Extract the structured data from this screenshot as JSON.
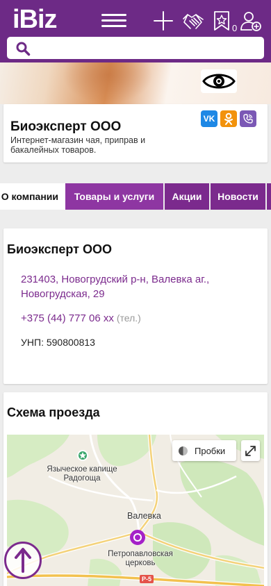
{
  "header": {
    "logo": "iBiz",
    "cart_count": "0",
    "icons": [
      "menu-icon",
      "plus-icon",
      "handshake-icon",
      "star-bookmark-icon",
      "add-user-icon"
    ]
  },
  "search": {
    "placeholder": "",
    "value": ""
  },
  "company": {
    "name": "Биоэксперт ООО",
    "description": "Интернет-магазин чая, приправ и бакалейных товаров.",
    "social": {
      "vk": "VK",
      "ok": "OK",
      "viber": ""
    }
  },
  "tabs": [
    {
      "label": "О компании",
      "active": true
    },
    {
      "label": "Товары и услуги",
      "active": false
    },
    {
      "label": "Акции",
      "active": false
    },
    {
      "label": "Новости",
      "active": false
    },
    {
      "label": "",
      "active": false
    }
  ],
  "info": {
    "title": "Биоэксперт ООО",
    "address": "231403, Новогрудский р-н, Валевка аг., Новогрудская, 29",
    "phone": "+375 (44) 777 06 xx",
    "phone_note": "(тел.)",
    "unp": "УНП: 590800813"
  },
  "map": {
    "title": "Схема проезда",
    "traffic_label": "Пробки",
    "labels": {
      "poi": "Языческое капище Радогоща",
      "town": "Валевка",
      "church": "Петропавловская церковь",
      "road": "Р-5"
    }
  },
  "colors": {
    "brand": "#6d2a86",
    "accent": "#7b2a8d",
    "tab_active_bg": "#ffffff"
  }
}
